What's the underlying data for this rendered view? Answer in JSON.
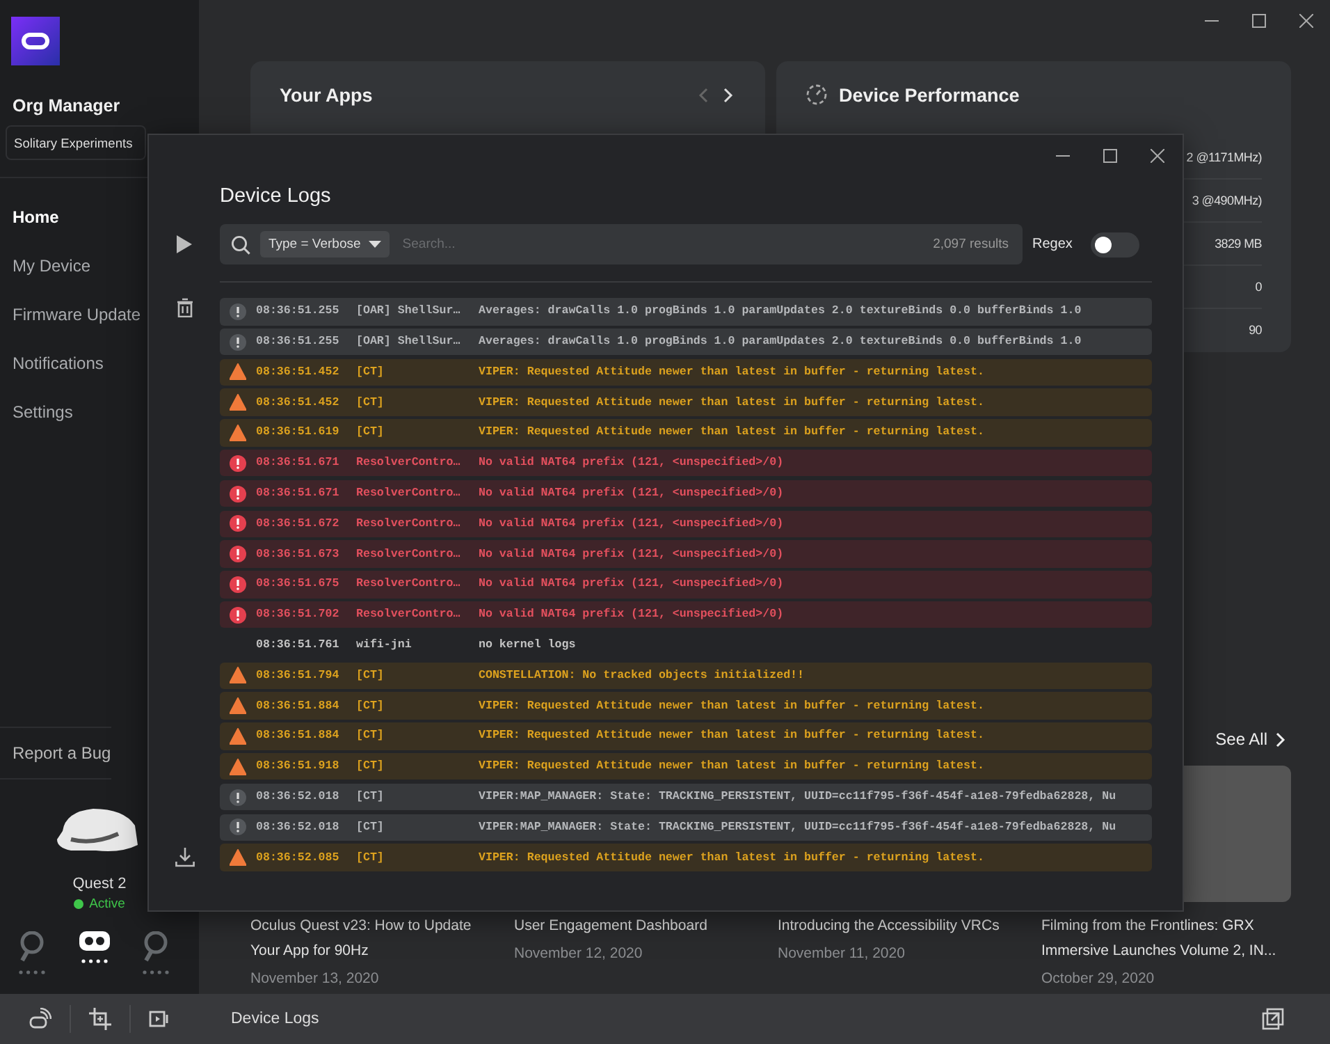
{
  "sidebar": {
    "org_title": "Org Manager",
    "org_select": "Solitary Experiments",
    "nav": [
      {
        "label": "Home",
        "selected": true
      },
      {
        "label": "My Device",
        "selected": false
      },
      {
        "label": "Firmware Update",
        "selected": false
      },
      {
        "label": "Notifications",
        "selected": false
      },
      {
        "label": "Settings",
        "selected": false
      }
    ],
    "report_bug": "Report a Bug",
    "device": {
      "name": "Quest 2",
      "status": "Active",
      "active": true
    },
    "device_parts": [
      {
        "kind": "controller",
        "selected": false
      },
      {
        "kind": "headset",
        "selected": true
      },
      {
        "kind": "controller",
        "selected": false
      }
    ]
  },
  "your_apps": {
    "title": "Your Apps"
  },
  "device_performance": {
    "title": "Device Performance",
    "rows": [
      "2 @1171MHz)",
      "3 @490MHz)",
      "3829 MB",
      "0",
      "90"
    ]
  },
  "see_all": "See All",
  "articles": [
    {
      "title": "Oculus Quest v23: How to Update Your App for 90Hz",
      "date": "November 13, 2020",
      "photo": false
    },
    {
      "title": "User Engagement Dashboard",
      "date": "November 12, 2020",
      "photo": false
    },
    {
      "title": "Introducing the Accessibility VRCs",
      "date": "November 11, 2020",
      "photo": false
    },
    {
      "title": "Filming from the Frontlines: GRX Immersive Launches Volume 2, IN...",
      "date": "October 29, 2020",
      "photo": true
    }
  ],
  "bottom_bar": {
    "label": "Device Logs"
  },
  "logs_window": {
    "title": "Device Logs",
    "filter_chip": "Type = Verbose",
    "search_placeholder": "Search...",
    "results": "2,097 results",
    "regex_label": "Regex",
    "regex_on": false,
    "entries": [
      {
        "kind": "info",
        "time": "08:36:51.255",
        "tag": "[OAR] ShellSur…",
        "message": "Averages: drawCalls 1.0 progBinds 1.0 paramUpdates 2.0 textureBinds 0.0 bufferBinds 1.0"
      },
      {
        "kind": "info",
        "time": "08:36:51.255",
        "tag": "[OAR] ShellSur…",
        "message": "Averages: drawCalls 1.0 progBinds 1.0 paramUpdates 2.0 textureBinds 0.0 bufferBinds 1.0"
      },
      {
        "kind": "warning",
        "time": "08:36:51.452",
        "tag": "[CT]",
        "message": "VIPER: Requested Attitude newer than latest in buffer - returning latest."
      },
      {
        "kind": "warning",
        "time": "08:36:51.452",
        "tag": "[CT]",
        "message": "VIPER: Requested Attitude newer than latest in buffer - returning latest."
      },
      {
        "kind": "warning",
        "time": "08:36:51.619",
        "tag": "[CT]",
        "message": "VIPER: Requested Attitude newer than latest in buffer - returning latest."
      },
      {
        "kind": "error",
        "time": "08:36:51.671",
        "tag": "ResolverContro…",
        "message": "No valid NAT64 prefix (121, <unspecified>/0)"
      },
      {
        "kind": "error",
        "time": "08:36:51.671",
        "tag": "ResolverContro…",
        "message": "No valid NAT64 prefix (121, <unspecified>/0)"
      },
      {
        "kind": "error",
        "time": "08:36:51.672",
        "tag": "ResolverContro…",
        "message": "No valid NAT64 prefix (121, <unspecified>/0)"
      },
      {
        "kind": "error",
        "time": "08:36:51.673",
        "tag": "ResolverContro…",
        "message": "No valid NAT64 prefix (121, <unspecified>/0)"
      },
      {
        "kind": "error",
        "time": "08:36:51.675",
        "tag": "ResolverContro…",
        "message": "No valid NAT64 prefix (121, <unspecified>/0)"
      },
      {
        "kind": "error",
        "time": "08:36:51.702",
        "tag": "ResolverContro…",
        "message": "No valid NAT64 prefix (121, <unspecified>/0)"
      },
      {
        "kind": "verbose",
        "time": "08:36:51.761",
        "tag": "wifi-jni",
        "message": "no kernel logs"
      },
      {
        "kind": "warning",
        "time": "08:36:51.794",
        "tag": "[CT]",
        "message": "CONSTELLATION: No tracked objects initialized!!"
      },
      {
        "kind": "warning",
        "time": "08:36:51.884",
        "tag": "[CT]",
        "message": "VIPER: Requested Attitude newer than latest in buffer - returning latest."
      },
      {
        "kind": "warning",
        "time": "08:36:51.884",
        "tag": "[CT]",
        "message": "VIPER: Requested Attitude newer than latest in buffer - returning latest."
      },
      {
        "kind": "warning",
        "time": "08:36:51.918",
        "tag": "[CT]",
        "message": "VIPER: Requested Attitude newer than latest in buffer - returning latest."
      },
      {
        "kind": "info",
        "time": "08:36:52.018",
        "tag": "[CT]",
        "message": "VIPER:MAP_MANAGER: State: TRACKING_PERSISTENT, UUID=cc11f795-f36f-454f-a1e8-79fedba62828, Nu"
      },
      {
        "kind": "info",
        "time": "08:36:52.018",
        "tag": "[CT]",
        "message": "VIPER:MAP_MANAGER: State: TRACKING_PERSISTENT, UUID=cc11f795-f36f-454f-a1e8-79fedba62828, Nu"
      },
      {
        "kind": "warning",
        "time": "08:36:52.085",
        "tag": "[CT]",
        "message": "VIPER: Requested Attitude newer than latest in buffer - returning latest."
      }
    ]
  }
}
